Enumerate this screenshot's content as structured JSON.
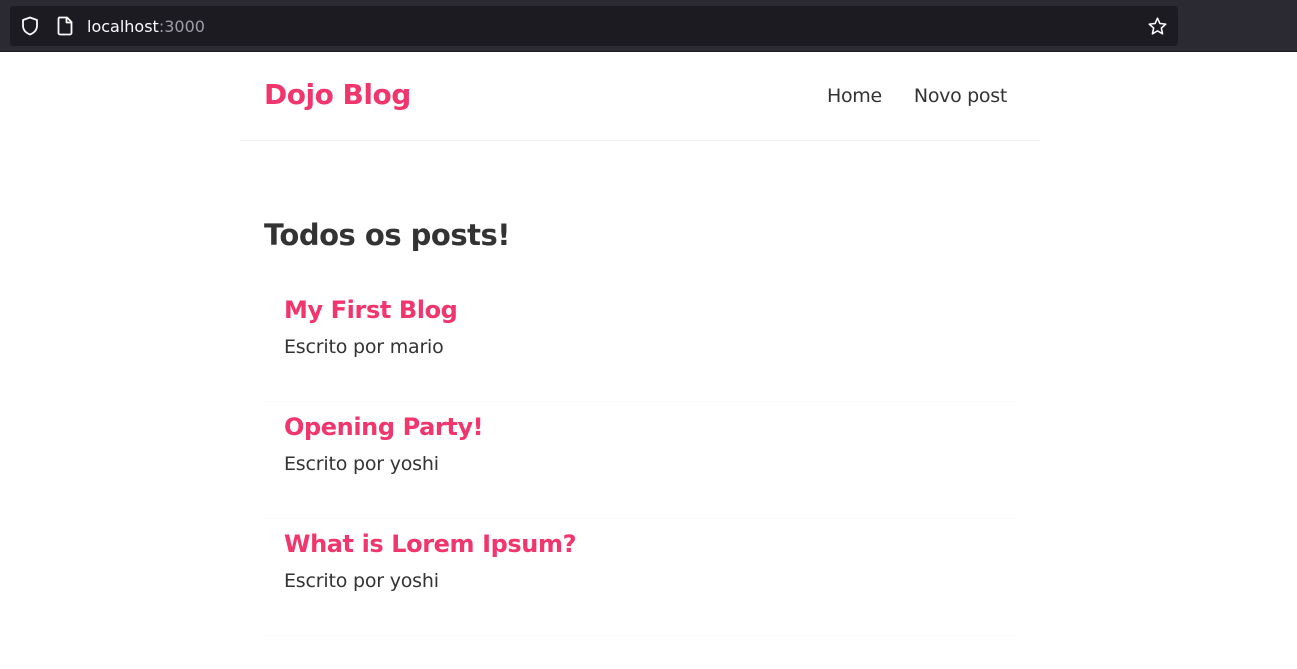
{
  "browser": {
    "url_host": "localhost",
    "url_port": ":3000",
    "icons": [
      "shield-icon",
      "page-icon",
      "star-icon"
    ]
  },
  "navbar": {
    "title": "Dojo Blog",
    "links": [
      {
        "label": "Home"
      },
      {
        "label": "Novo post"
      }
    ]
  },
  "main": {
    "heading": "Todos os posts!",
    "posts": [
      {
        "title": "My First Blog",
        "author_line": "Escrito por mario"
      },
      {
        "title": "Opening Party!",
        "author_line": "Escrito por yoshi"
      },
      {
        "title": "What is Lorem Ipsum?",
        "author_line": "Escrito por yoshi"
      }
    ]
  },
  "colors": {
    "accent": "#f1356d",
    "text": "#333333",
    "chrome_bg": "#2b2a33",
    "url_bg": "#1c1b22"
  }
}
